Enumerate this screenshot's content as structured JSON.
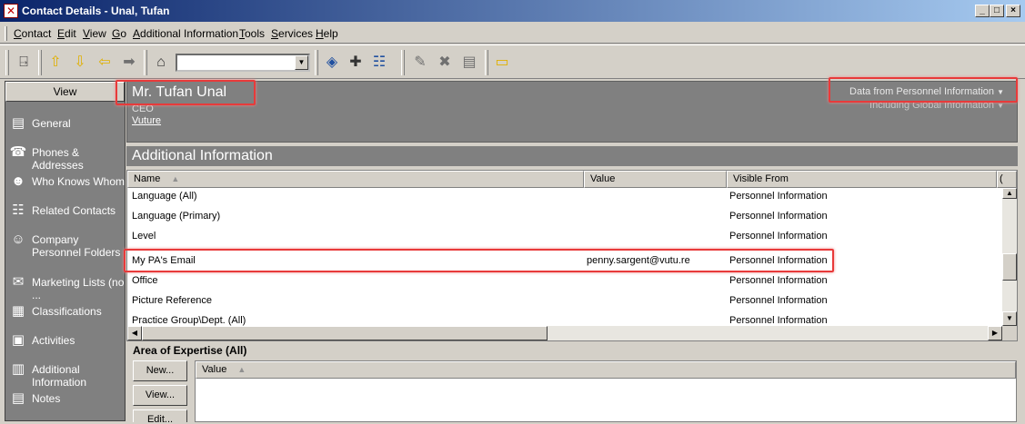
{
  "window": {
    "title": "Contact Details - Unal, Tufan",
    "minimize": "_",
    "maximize": "□",
    "close": "×"
  },
  "menu": [
    {
      "label": "Contact"
    },
    {
      "label": "Edit"
    },
    {
      "label": "View"
    },
    {
      "label": "Go"
    },
    {
      "label": "Additional Information"
    },
    {
      "label": "Tools"
    },
    {
      "label": "Services"
    },
    {
      "label": "Help"
    }
  ],
  "toolbar": {
    "search_value": "",
    "icons": [
      "exit-door-icon",
      "arrow-up-icon",
      "arrow-down-icon",
      "arrow-left-icon",
      "arrow-right-icon",
      "home-icon",
      "link-diamond-icon",
      "new-item-icon",
      "who-knows-icon",
      "edit-pencil-icon",
      "delete-icon",
      "vcard-icon",
      "folder-icon"
    ]
  },
  "sidebar": {
    "header": "View",
    "items": [
      {
        "label": "General",
        "icon": "general-icon"
      },
      {
        "label": "Phones & Addresses",
        "icon": "phones-icon"
      },
      {
        "label": "Who Knows Whom",
        "icon": "who-knows-icon"
      },
      {
        "label": "Related Contacts",
        "icon": "related-icon"
      },
      {
        "label": "Company Personnel Folders",
        "icon": "personnel-icon"
      },
      {
        "label": "Marketing Lists (no ...",
        "icon": "marketing-icon"
      },
      {
        "label": "Classifications",
        "icon": "classifications-icon"
      },
      {
        "label": "Activities",
        "icon": "activities-icon"
      },
      {
        "label": "Additional Information",
        "icon": "additional-icon"
      },
      {
        "label": "Notes",
        "icon": "notes-icon"
      }
    ]
  },
  "contact": {
    "name": "Mr. Tufan Unal",
    "title": "CEO",
    "company": "Vuture",
    "data_source": "Data from Personnel Information",
    "including_global": "Including Global Information"
  },
  "section": {
    "title": "Additional Information"
  },
  "grid": {
    "columns": [
      "Name",
      "Value",
      "Visible From",
      "("
    ],
    "rows": [
      {
        "name": "Language (All)",
        "value": "",
        "visible_from": "Personnel Information"
      },
      {
        "name": "Language (Primary)",
        "value": "",
        "visible_from": "Personnel Information"
      },
      {
        "name": "Level",
        "value": "",
        "visible_from": "Personnel Information"
      },
      {
        "name": "My PA's Email",
        "value": "penny.sargent@vutu.re",
        "visible_from": "Personnel Information"
      },
      {
        "name": "Office",
        "value": "",
        "visible_from": "Personnel Information"
      },
      {
        "name": "Picture Reference",
        "value": "",
        "visible_from": "Personnel Information"
      },
      {
        "name": "Practice Group\\Dept. (All)",
        "value": "",
        "visible_from": "Personnel Information"
      }
    ]
  },
  "expertise": {
    "title": "Area of Expertise (All)",
    "new_label": "New...",
    "view_label": "View...",
    "edit_label": "Edit...",
    "column": "Value"
  },
  "colors": {
    "titlebar_start": "#0a246a",
    "panel_gray": "#808080",
    "highlight": "#e83a3a"
  }
}
